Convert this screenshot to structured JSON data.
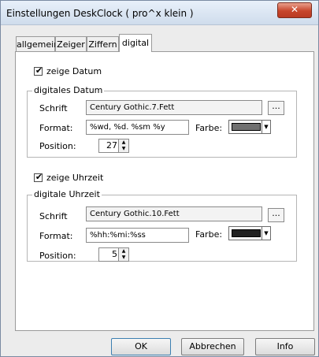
{
  "window": {
    "title": "Einstellungen DeskClock ( pro^x klein )",
    "close_glyph": "✕"
  },
  "tabs": [
    {
      "label": "allgemein"
    },
    {
      "label": "Zeiger"
    },
    {
      "label": "Ziffern"
    },
    {
      "label": "digital",
      "active": true
    }
  ],
  "date_section": {
    "show_checkbox": {
      "label": "zeige Datum",
      "checked": true
    },
    "group_label": "digitales Datum",
    "font_label": "Schrift",
    "font_value": "Century Gothic.7.Fett",
    "browse_label": "...",
    "format_label": "Format:",
    "format_value": "%wd, %d. %sm %y",
    "color_label": "Farbe:",
    "color_value": "#707070",
    "position_label": "Position:",
    "position_value": "27"
  },
  "time_section": {
    "show_checkbox": {
      "label": "zeige Uhrzeit",
      "checked": true
    },
    "group_label": "digitale Uhrzeit",
    "font_label": "Schrift",
    "font_value": "Century Gothic.10.Fett",
    "browse_label": "...",
    "format_label": "Format:",
    "format_value": "%hh:%mi:%ss",
    "color_label": "Farbe:",
    "color_value": "#202020",
    "position_label": "Position:",
    "position_value": "5"
  },
  "buttons": {
    "ok": "OK",
    "cancel": "Abbrechen",
    "info": "Info"
  },
  "glyphs": {
    "check": "✔",
    "dropdown": "▼",
    "up": "▲",
    "down": "▼"
  }
}
